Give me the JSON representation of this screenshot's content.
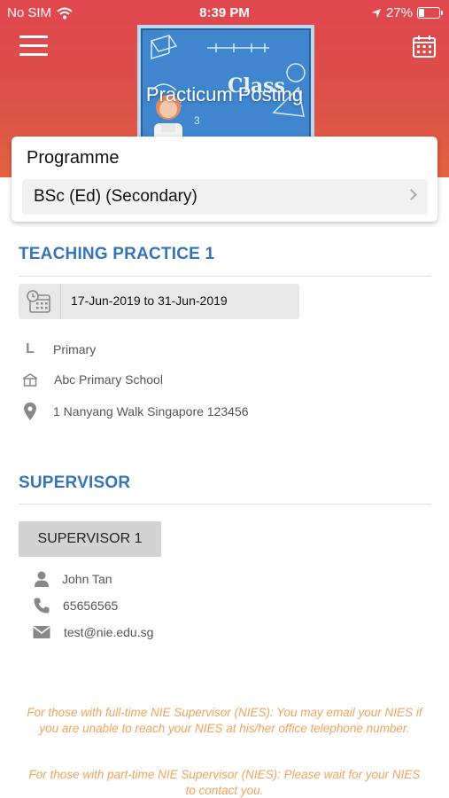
{
  "status_bar": {
    "carrier": "No SIM",
    "time": "8:39 PM",
    "battery_percent": "27%",
    "battery_level": 0.27
  },
  "header": {
    "title": "Practicum Posting",
    "board_text": "Class",
    "menu_icon": "hamburger-icon",
    "calendar_icon": "calendar-icon",
    "background_color": "#e0474f"
  },
  "programme": {
    "label": "Programme",
    "selected": "BSc (Ed) (Secondary)"
  },
  "teaching_practice": {
    "heading": "TEACHING PRACTICE 1",
    "date_range": "17-Jun-2019 to 31-Jun-2019",
    "level_letter": "L",
    "level": "Primary",
    "school": "Abc Primary School",
    "address": "1 Nanyang Walk Singapore 123456"
  },
  "supervisor": {
    "heading": "SUPERVISOR",
    "tab_label": "SUPERVISOR 1",
    "name": "John Tan",
    "phone": "65656565",
    "email": "test@nie.edu.sg"
  },
  "notes": {
    "full_time": "For those with full-time NIE Supervisor (NIES): You may email your NIES if you are unable to reach your NIES at his/her office telephone number.",
    "part_time": "For those with part-time NIE Supervisor (NIES): Please wait for your NIES to contact you."
  },
  "colors": {
    "accent_blue": "#3575b5",
    "note_orange": "#f0a25a"
  }
}
